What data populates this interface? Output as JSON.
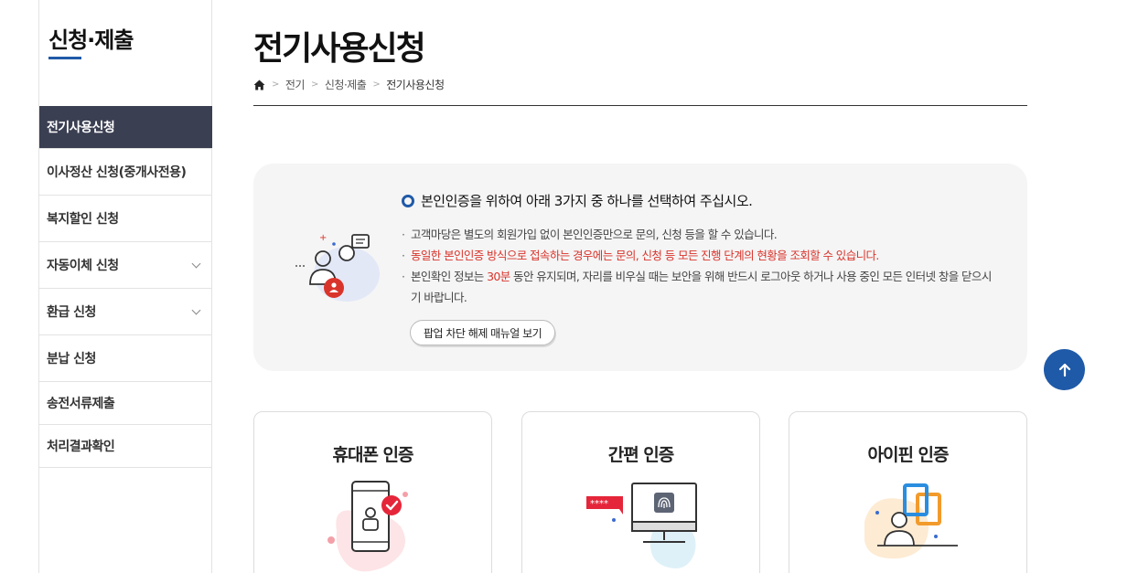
{
  "sidebar": {
    "title": "신청·제출",
    "items": [
      {
        "label": "전기사용신청",
        "active": true
      },
      {
        "label": "이사정산 신청(중개사전용)",
        "active": false
      },
      {
        "label": "복지할인 신청",
        "active": false
      },
      {
        "label": "자동이체 신청",
        "active": false,
        "expandable": true
      },
      {
        "label": "환급 신청",
        "active": false,
        "expandable": true
      },
      {
        "label": "분납 신청",
        "active": false
      },
      {
        "label": "송전서류제출",
        "active": false
      },
      {
        "label": "처리결과확인",
        "active": false
      }
    ]
  },
  "page": {
    "title": "전기사용신청",
    "breadcrumb": [
      "전기",
      "신청·제출",
      "전기사용신청"
    ]
  },
  "notice": {
    "heading": "본인인증을 위하여 아래 3가지 중 하나를 선택하여 주십시오.",
    "line1": "고객마당은 별도의 회원가입 없이 본인인증만으로 문의, 신청 등을 할 수 있습니다.",
    "line2": "동일한 본인인증 방식으로 접속하는 경우에는 문의, 신청 등 모든 진행 단계의 현황을 조회할 수 있습니다.",
    "line3_before": "본인확인 정보는 ",
    "line3_highlight": "30분",
    "line3_after": " 동안 유지되며, 자리를 비우실 때는 보안을 위해 반드시 로그아웃 하거나 사용 중인 모든 인터넷 창을 닫으시기 바랍니다.",
    "popup_button": "팝업 차단 해제 매뉴얼 보기"
  },
  "cards": [
    {
      "title": "휴대폰 인증",
      "icon": "smartphone-icon"
    },
    {
      "title": "간편 인증",
      "icon": "monitor-fingerprint-icon"
    },
    {
      "title": "아이핀 인증",
      "icon": "person-ipin-icon"
    }
  ],
  "colors": {
    "brand": "#1f5aa8",
    "sidebar_active": "#3b3f52",
    "alert": "#d9342b",
    "notice_bg": "#f5f5f5"
  }
}
